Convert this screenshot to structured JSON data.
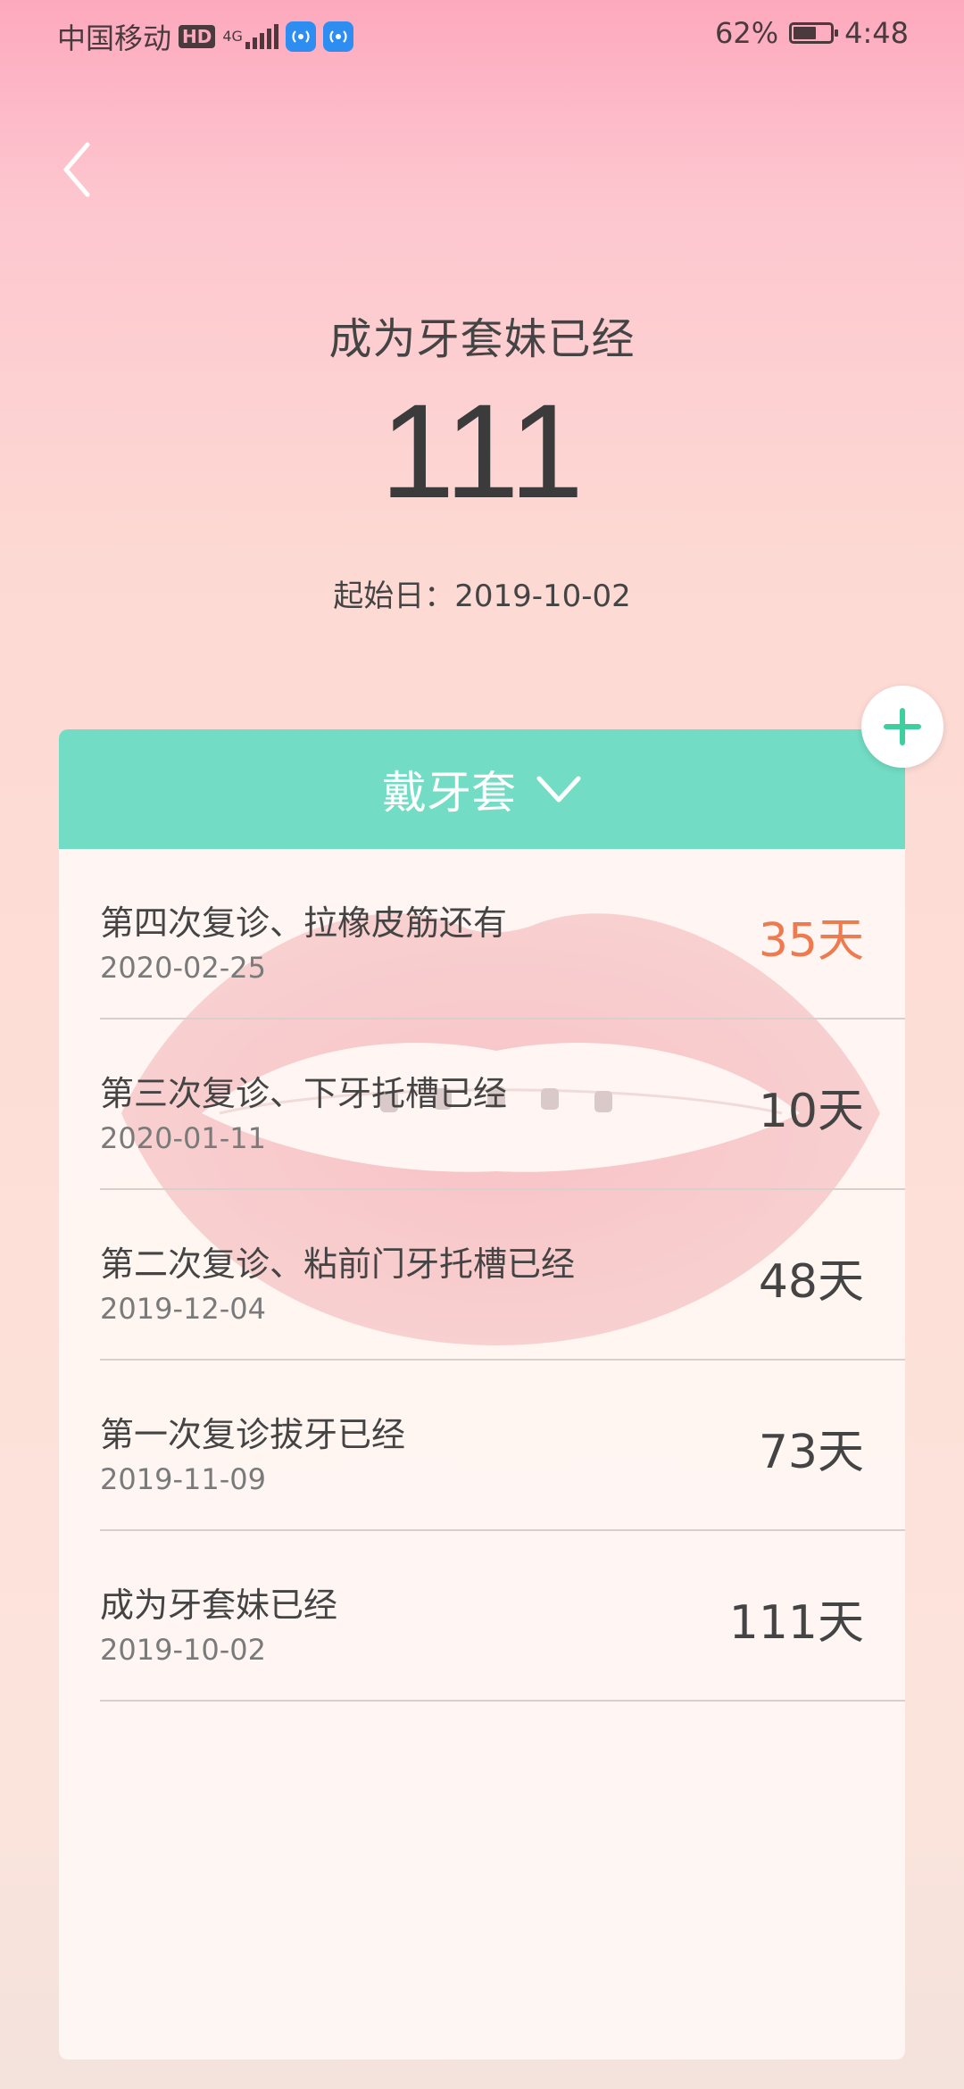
{
  "status_bar": {
    "carrier": "中国移动",
    "hd": "HD",
    "net": "4G",
    "battery_text": "62%",
    "battery_level": 0.62,
    "time": "4:48"
  },
  "header": {
    "title": "成为牙套妹已经",
    "count": "111",
    "start_label": "起始日：2019-10-02"
  },
  "card": {
    "category_label": "戴牙套"
  },
  "events": [
    {
      "title": "第四次复诊、拉橡皮筋还有",
      "date": "2020-02-25",
      "days": "35天",
      "highlight": true
    },
    {
      "title": "第三次复诊、下牙托槽已经",
      "date": "2020-01-11",
      "days": "10天",
      "highlight": false
    },
    {
      "title": "第二次复诊、粘前门牙托槽已经",
      "date": "2019-12-04",
      "days": "48天",
      "highlight": false
    },
    {
      "title": "第一次复诊拔牙已经",
      "date": "2019-11-09",
      "days": "73天",
      "highlight": false
    },
    {
      "title": "成为牙套妹已经",
      "date": "2019-10-02",
      "days": "111天",
      "highlight": false
    }
  ],
  "colors": {
    "accent": "#72dcc4",
    "highlight": "#ee7b4f",
    "add_icon": "#3fcf9f"
  }
}
